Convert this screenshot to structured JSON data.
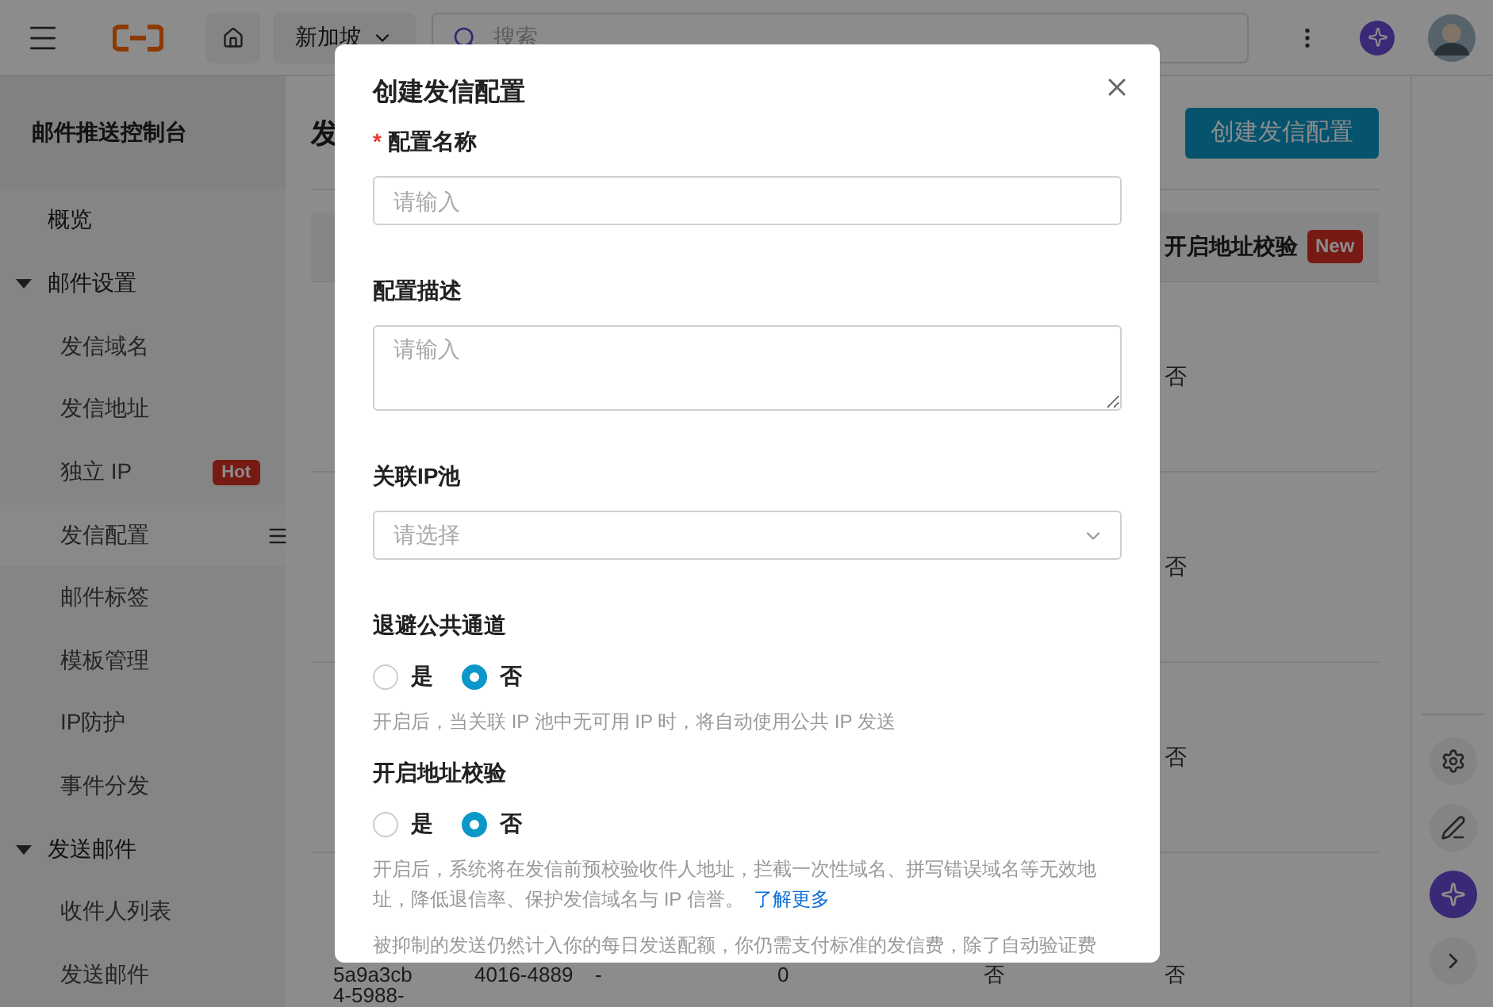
{
  "topbar": {
    "region": "新加坡",
    "search_placeholder": "搜索"
  },
  "sidebar": {
    "title": "邮件推送控制台",
    "items": [
      {
        "label": "概览",
        "selected": false
      },
      {
        "label": "邮件设置",
        "selected": false,
        "expanded": true,
        "children": [
          {
            "label": "发信域名",
            "selected": false
          },
          {
            "label": "发信地址",
            "selected": false
          },
          {
            "label": "独立 IP",
            "selected": false,
            "badge": "Hot"
          },
          {
            "label": "发信配置",
            "selected": true
          },
          {
            "label": "邮件标签",
            "selected": false
          },
          {
            "label": "模板管理",
            "selected": false
          },
          {
            "label": "IP防护",
            "selected": false
          },
          {
            "label": "事件分发",
            "selected": false
          }
        ]
      },
      {
        "label": "发送邮件",
        "selected": false,
        "expanded": true,
        "children": [
          {
            "label": "收件人列表",
            "selected": false
          },
          {
            "label": "发送邮件",
            "selected": false
          }
        ]
      }
    ]
  },
  "main": {
    "title": "发",
    "create_button": "创建发信配置",
    "table": {
      "header": {
        "label": "开启地址校验",
        "badge": "New"
      },
      "rows": [
        {
          "column_6": "否"
        },
        {
          "column_6": "否"
        },
        {
          "column_6": "否"
        },
        {
          "column_1": [
            "5a9a3cb",
            "4-5988-"
          ],
          "column_2": "4016-4889",
          "column_3": "-",
          "column_4": "0",
          "column_5": "否",
          "column_6": "否"
        }
      ]
    }
  },
  "modal": {
    "title": "创建发信配置",
    "fields": [
      {
        "kind": "text",
        "label": "配置名称",
        "required_mark": "*",
        "placeholder": "请输入"
      },
      {
        "kind": "textarea",
        "label": "配置描述",
        "placeholder": "请输入"
      },
      {
        "kind": "select",
        "label": "关联IP池",
        "placeholder": "请选择"
      },
      {
        "kind": "radio",
        "label": "退避公共通道",
        "options": [
          {
            "label": "是",
            "selected": false
          },
          {
            "label": "否",
            "selected": true
          }
        ],
        "help": "开启后，当关联 IP 池中无可用 IP 时，将自动使用公共 IP 发送"
      },
      {
        "kind": "radio",
        "label": "开启地址校验",
        "options": [
          {
            "label": "是",
            "selected": false
          },
          {
            "label": "否",
            "selected": true
          }
        ],
        "help": "开启后，系统将在发信前预校验收件人地址，拦截一次性域名、拼写错误域名等无效地址，降低退信率、保护发信域名与 IP 信誉。",
        "link": "了解更多"
      }
    ],
    "note": "被抑制的发送仍然计入你的每日发送配额，你仍需支付标准的发信费，除了自动验证费"
  }
}
